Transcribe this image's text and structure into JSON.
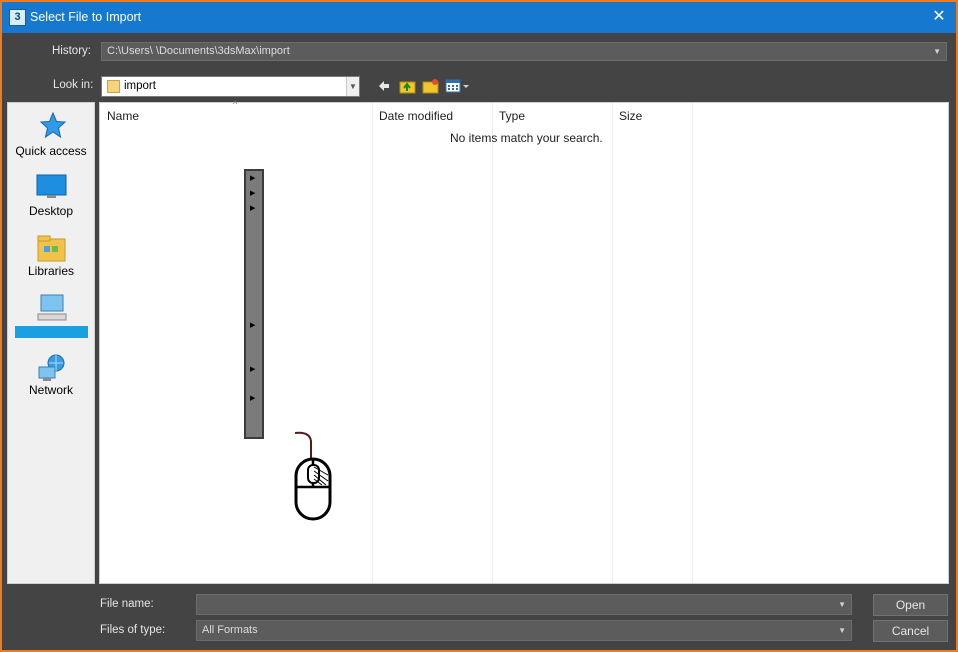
{
  "window": {
    "title": "Select File to Import",
    "app_icon_text": "3",
    "close_glyph": "✕",
    "accent_color": "#1679cf",
    "border_color": "#f07a1c"
  },
  "history": {
    "label": "History:",
    "value": "C:\\Users\\            \\Documents\\3dsMax\\import"
  },
  "lookin": {
    "label": "Look in:",
    "value": "import",
    "toolbar_icons": [
      "back-arrow-icon",
      "up-folder-icon",
      "new-folder-icon",
      "view-menu-icon"
    ]
  },
  "places": [
    {
      "label": "Quick access",
      "icon": "star-icon"
    },
    {
      "label": "Desktop",
      "icon": "desktop-icon"
    },
    {
      "label": "Libraries",
      "icon": "libraries-icon"
    },
    {
      "label": "",
      "icon": "computer-icon",
      "selected": true
    },
    {
      "label": "Network",
      "icon": "network-icon"
    }
  ],
  "columns": [
    "Name",
    "Date modified",
    "Type",
    "Size"
  ],
  "empty_message": "No items match your search.",
  "filename": {
    "label": "File name:",
    "value": ""
  },
  "filetype": {
    "label": "Files of type:",
    "value": "All Formats"
  },
  "buttons": {
    "open": "Open",
    "cancel": "Cancel"
  }
}
